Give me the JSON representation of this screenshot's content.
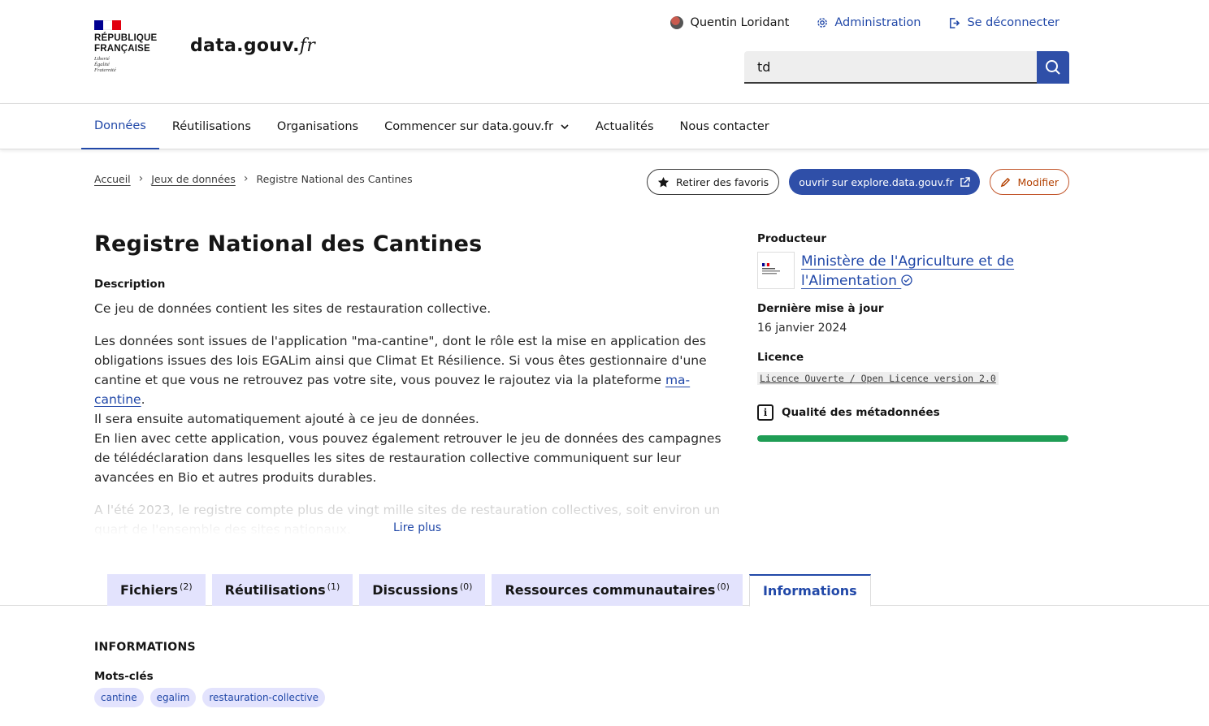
{
  "header": {
    "republic_line1": "RÉPUBLIQUE",
    "republic_line2": "FRANÇAISE",
    "motto": [
      "Liberté",
      "Égalité",
      "Fraternité"
    ],
    "site_name_main": "data.gouv.",
    "site_name_suffix": "fr",
    "user_name": "Quentin Loridant",
    "admin_label": "Administration",
    "logout_label": "Se déconnecter",
    "search_value": "td",
    "flag_colors": [
      "#000091",
      "#ffffff",
      "#e1000f"
    ]
  },
  "nav": {
    "items": [
      "Données",
      "Réutilisations",
      "Organisations",
      "Commencer sur data.gouv.fr",
      "Actualités",
      "Nous contacter"
    ]
  },
  "breadcrumb": {
    "home": "Accueil",
    "datasets": "Jeux de données",
    "current": "Registre National des Cantines"
  },
  "actions": {
    "unfavorite": "Retirer des favoris",
    "explore": "ouvrir sur explore.data.gouv.fr",
    "edit": "Modifier"
  },
  "dataset": {
    "title": "Registre National des Cantines",
    "description_label": "Description",
    "p1": "Ce jeu de données contient les sites de restauration collective.",
    "p2_before_link": "Les données sont issues de l'application \"ma-cantine\", dont le rôle est la mise en application des obligations issues des lois EGALim ainsi que Climat Et Résilience. Si vous êtes gestionnaire d'une cantine et que vous ne retrouvez pas votre site, vous pouvez le rajoutez via la plateforme ",
    "p2_link": "ma-cantine",
    "p2_after_link": ".",
    "p2_line2": "Il sera ensuite automatiquement ajouté à ce jeu de données.",
    "p2_line3": "En lien avec cette application, vous pouvez également retrouver le jeu de données des campagnes de télédéclaration dans lesquelles les sites de restauration collective communiquent sur leur avancées en Bio et autres produits durables.",
    "p3": "A l'été 2023, le registre compte plus de vingt mille sites de restauration collectives, soit environ un quart de l'ensemble des sites nationaux.",
    "read_more": "Lire plus"
  },
  "sidebar": {
    "producer_label": "Producteur",
    "producer_name": "Ministère de l'Agriculture et de l'Alimentation",
    "updated_label": "Dernière mise à jour",
    "updated_value": "16 janvier 2024",
    "license_label": "Licence",
    "license_value": "Licence Ouverte / Open Licence version 2.0",
    "quality_label": "Qualité des métadonnées",
    "quality_fraction": 1.0,
    "quality_color": "#1f9d55"
  },
  "tabs": [
    {
      "label": "Fichiers",
      "count": "(2)"
    },
    {
      "label": "Réutilisations",
      "count": "(1)"
    },
    {
      "label": "Discussions",
      "count": "(0)"
    },
    {
      "label": "Ressources communautaires",
      "count": "(0)"
    },
    {
      "label": "Informations",
      "count": ""
    }
  ],
  "informations": {
    "heading": "INFORMATIONS",
    "keywords_label": "Mots-clés",
    "keywords": [
      "cantine",
      "egalim",
      "restauration-collective"
    ]
  }
}
